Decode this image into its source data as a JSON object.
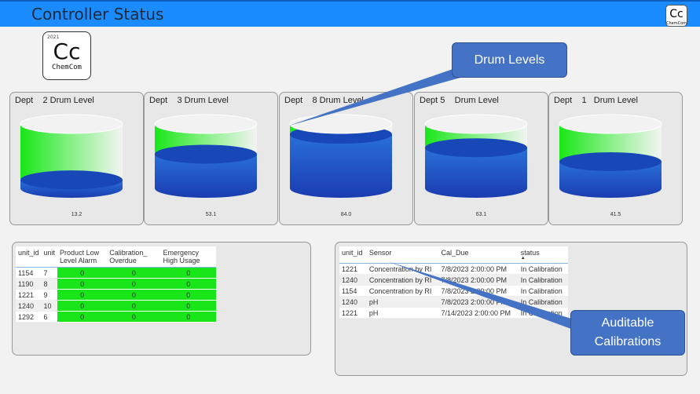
{
  "header": {
    "title": "Controller Status",
    "mini_logo": "Cc",
    "mini_logo_sub": "ChemCom"
  },
  "logo": {
    "year": "2021",
    "symbol": "Cc",
    "name": "ChemCom"
  },
  "drums": [
    {
      "title": "Dept    2 Drum Level",
      "level": 13.2,
      "label": "13.2"
    },
    {
      "title": "Dept    3 Drum Level",
      "level": 53.1,
      "label": "53.1"
    },
    {
      "title": "Dept    8 Drum Level",
      "level": 84.0,
      "label": "84.0"
    },
    {
      "title": "Dept 5    Drum Level",
      "level": 63.1,
      "label": "63.1"
    },
    {
      "title": "Dept    1   Drum Level",
      "level": 41.5,
      "label": "41.5"
    }
  ],
  "colors": {
    "liquid": "#1848b8",
    "full": "#19e619",
    "alarm_red": "#e01010",
    "alarm_yellow": "#f0e020",
    "callout": "#4472c4"
  },
  "alarm_table": {
    "headers": [
      "unit_id",
      "unit",
      "Product Low Level Alarm",
      "Calibration_ Overdue",
      "Emergency High Usage"
    ],
    "rows": [
      [
        "1154",
        "7",
        "0",
        "0",
        "0"
      ],
      [
        "1190",
        "8",
        "0",
        "0",
        "0"
      ],
      [
        "1221",
        "9",
        "0",
        "0",
        "0"
      ],
      [
        "1240",
        "10",
        "0",
        "0",
        "0"
      ],
      [
        "1292",
        "6",
        "0",
        "0",
        "0"
      ]
    ]
  },
  "cal_table": {
    "headers": [
      "unit_id",
      "Sensor",
      "Cal_Due",
      "status"
    ],
    "sort_indicator": "▲",
    "rows": [
      [
        "1221",
        "Concentration by RI",
        "7/8/2023 2:00:00 PM",
        "In Calibration"
      ],
      [
        "1240",
        "Concentration by RI",
        "7/8/2023 2:00:00 PM",
        "In Calibration"
      ],
      [
        "1154",
        "Concentration by RI",
        "7/8/2023 2:00:00 PM",
        "In Calibration"
      ],
      [
        "1240",
        "pH",
        "7/8/2023 2:00:00 PM",
        "In Calibration"
      ],
      [
        "1221",
        "pH",
        "7/14/2023 2:00:00 PM",
        "In Calibration"
      ]
    ]
  },
  "callouts": {
    "drum": "Drum Levels",
    "cal": "Auditable Calibrations"
  }
}
